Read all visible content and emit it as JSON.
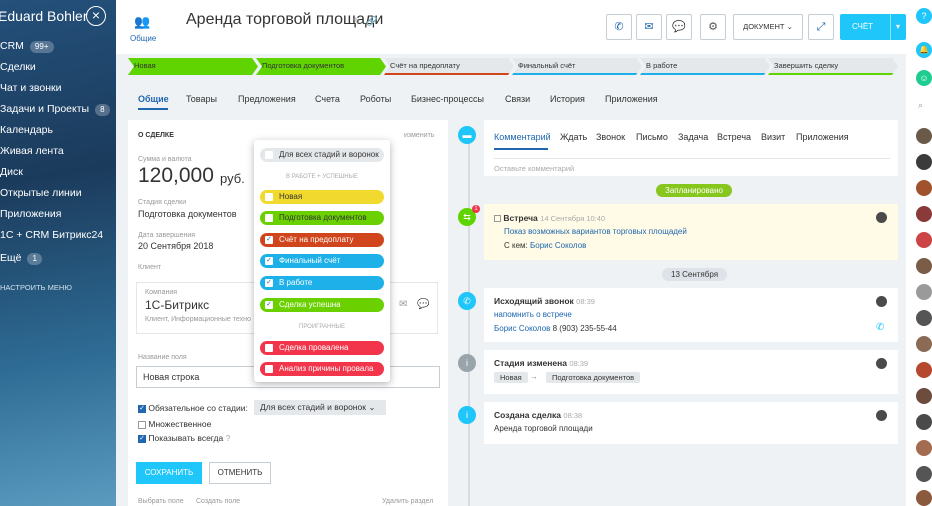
{
  "sidebar": {
    "user": "Eduard Bohler",
    "crm_label": "CRM",
    "crm_badge": "99+",
    "items": [
      "Сделки",
      "Чат и звонки",
      "Задачи и Проекты",
      "Календарь",
      "Живая лента",
      "Диск",
      "Открытые линии",
      "Приложения",
      "1С + CRM Битрикс24",
      "Ещё"
    ],
    "tasks_badge": "8",
    "more_badge": "1",
    "settings": "НАСТРОИТЬ МЕНЮ"
  },
  "header": {
    "title": "Аренда торговой площади",
    "breadcrumb": "Общие",
    "doc_button": "ДОКУМЕНТ",
    "invoice_button": "СЧЁТ"
  },
  "stages": [
    {
      "label": "Новая",
      "color": "#5fd400"
    },
    {
      "label": "Подготовка документов",
      "color": "#5fd400"
    },
    {
      "label": "Счёт на предоплату",
      "color": "#e5e8ea"
    },
    {
      "label": "Финальный счёт",
      "color": "#e5e8ea"
    },
    {
      "label": "В работе",
      "color": "#e5e8ea"
    },
    {
      "label": "Завершить сделку",
      "color": "#e5e8ea"
    }
  ],
  "tabs": [
    "Общие",
    "Товары",
    "Предложения",
    "Счета",
    "Роботы",
    "Бизнес-процессы",
    "Связи",
    "История",
    "Приложения"
  ],
  "deal": {
    "section_title": "О СДЕЛКЕ",
    "edit": "изменить",
    "sum_label": "Сумма и валюта",
    "sum_value": "120,000",
    "currency": "руб.",
    "stage_label": "Стадия сделки",
    "stage_value": "Подготовка документов",
    "date_label": "Дата завершения",
    "date_value": "20 Сентября 2018",
    "client_label": "Клиент",
    "company_label": "Компания",
    "company": "1С-Битрикс",
    "company_sub": "Клиент, Информационные техно",
    "field_name_label": "Название поля",
    "field_name_value": "Новая строка",
    "required_label": "Обязательное со стадии:",
    "required_select": "Для всех стадий и воронок",
    "multiple_label": "Множественное",
    "always_label": "Показывать всегда",
    "save": "СОХРАНИТЬ",
    "cancel": "ОТМЕНИТЬ",
    "select_field": "Выбрать поле",
    "create_field": "Создать поле",
    "delete_section": "Удалить раздел"
  },
  "dropdown": {
    "all": "Для всех стадий и воронок",
    "group1": "В РАБОТЕ + УСПЕШНЫЕ",
    "group2": "ПРОИГРАННЫЕ",
    "options": [
      {
        "label": "Новая",
        "color": "#f1d92d",
        "checked": false
      },
      {
        "label": "Подготовка документов",
        "color": "#6ad000",
        "checked": false
      },
      {
        "label": "Счёт на предоплату",
        "color": "#d0451b",
        "checked": true
      },
      {
        "label": "Финальный счёт",
        "color": "#1eb0e8",
        "checked": true
      },
      {
        "label": "В работе",
        "color": "#1eb0e8",
        "checked": true
      },
      {
        "label": "Сделка успешна",
        "color": "#6ad000",
        "checked": true
      },
      {
        "label": "Сделка провалена",
        "color": "#f2354a",
        "checked": false
      },
      {
        "label": "Анализ причины провала",
        "color": "#f2354a",
        "checked": false
      }
    ]
  },
  "activity": {
    "tabs": [
      "Комментарий",
      "Ждать",
      "Звонок",
      "Письмо",
      "Задача",
      "Встреча",
      "Визит",
      "Приложения"
    ],
    "placeholder": "Оставьте комментарий",
    "planned": "Запланировано",
    "meeting_title": "Встреча",
    "meeting_date": "14 Сентября 10:40",
    "meeting_link": "Показ возможных вариантов торговых площадей",
    "meeting_with_label": "С кем:",
    "meeting_with": "Борис Соколов",
    "date_sep": "13 Сентября",
    "call_title": "Исходящий звонок",
    "call_time": "08:39",
    "call_link": "напомнить о встрече",
    "call_person": "Борис Соколов",
    "call_phone": "8 (903) 235-55-44",
    "stage_title": "Стадия изменена",
    "stage_time": "08:39",
    "stage_from": "Новая",
    "stage_to": "Подготовка документов",
    "created_title": "Создана сделка",
    "created_time": "08:38",
    "created_text": "Аренда торговой площади",
    "alert_badge": "1"
  }
}
